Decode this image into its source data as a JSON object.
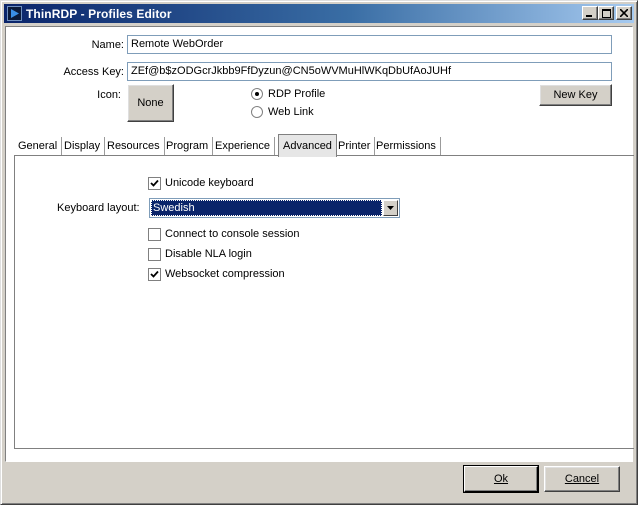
{
  "window": {
    "title": "ThinRDP - Profiles Editor",
    "controls": [
      "minimize",
      "maximize",
      "close"
    ]
  },
  "form": {
    "name_label": "Name:",
    "name_value": "Remote WebOrder",
    "access_key_label": "Access Key:",
    "access_key_value": "ZEf@b$zODGcrJkbb9FfDyzun@CN5oWVMuHlWKqDbUfAoJUHf",
    "icon_label": "Icon:",
    "icon_button": "None",
    "profile_types": [
      {
        "label": "RDP Profile",
        "selected": true
      },
      {
        "label": "Web Link",
        "selected": false
      }
    ],
    "new_key_button": "New Key"
  },
  "tabs": [
    {
      "label": "General",
      "active": false
    },
    {
      "label": "Display",
      "active": false
    },
    {
      "label": "Resources",
      "active": false
    },
    {
      "label": "Program",
      "active": false
    },
    {
      "label": "Experience",
      "active": false
    },
    {
      "label": "Advanced",
      "active": true
    },
    {
      "label": "Printer",
      "active": false
    },
    {
      "label": "Permissions",
      "active": false
    }
  ],
  "advanced": {
    "unicode_keyboard": {
      "label": "Unicode keyboard",
      "checked": true
    },
    "keyboard_layout_label": "Keyboard layout:",
    "keyboard_layout_value": "Swedish",
    "connect_console": {
      "label": "Connect to console session",
      "checked": false
    },
    "disable_nla": {
      "label": "Disable NLA login",
      "checked": false
    },
    "websocket_compression": {
      "label": "Websocket compression",
      "checked": true
    }
  },
  "footer": {
    "ok_button": "Ok",
    "cancel_button": "Cancel"
  },
  "colors": {
    "title_start": "#0a246a",
    "title_end": "#a6caf0",
    "face": "#d4d0c8",
    "selection": "#0a246a"
  }
}
